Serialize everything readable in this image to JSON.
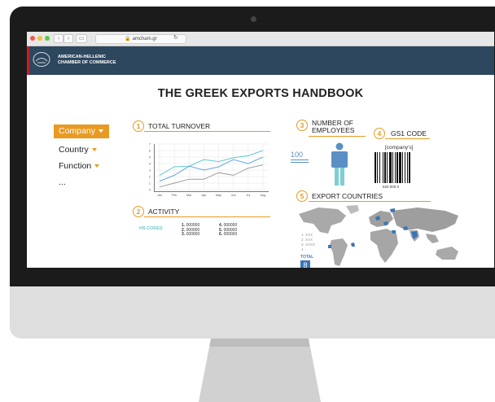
{
  "browser": {
    "url": "amcham.gr",
    "traffic_lights": [
      "#ee5b52",
      "#f5bd3a",
      "#5bc94a"
    ]
  },
  "header": {
    "org_line1": "AMERICAN-HELLENIC",
    "org_line2": "CHAMBER OF COMMERCE"
  },
  "page": {
    "title": "THE GREEK EXPORTS HANDBOOK"
  },
  "filters": {
    "items": [
      "Company",
      "Country",
      "Function",
      "..."
    ]
  },
  "sections": {
    "turnover": {
      "number": "1",
      "title": "TOTAL TURNOVER"
    },
    "activity": {
      "number": "2",
      "title": "ACTIVITY"
    },
    "employees": {
      "number": "3",
      "title_line1": "NUMBER OF",
      "title_line2": "EMPLOYEES",
      "count": "100"
    },
    "gs1": {
      "number": "4",
      "title": "GS1 CODE",
      "placeholder": "[company's]",
      "code_number": "520 000 0"
    },
    "export": {
      "number": "5",
      "title": "EXPORT COUNTRIES",
      "total_label": "TOTAL",
      "total_value": "8",
      "legend": [
        "1. XXX",
        "2. XXX",
        "3. XXXX",
        "4."
      ]
    }
  },
  "activity": {
    "hs_label": "HS CODES",
    "codes": [
      {
        "idx": "1.",
        "code": "000000"
      },
      {
        "idx": "2.",
        "code": "000000"
      },
      {
        "idx": "3.",
        "code": "000000"
      },
      {
        "idx": "4.",
        "code": "000000"
      },
      {
        "idx": "5.",
        "code": "000000"
      },
      {
        "idx": "6.",
        "code": "000000"
      }
    ]
  },
  "colors": {
    "accent": "#e89a22",
    "header_bg": "#2d475e",
    "header_accent": "#c81e2a",
    "figure": "#5b8fc6",
    "highlight": "#3a76b7"
  },
  "chart_data": {
    "type": "line",
    "categories": [
      "Jan",
      "Feb",
      "Mar",
      "Apr",
      "May",
      "Jun",
      "Jul",
      "Aug"
    ],
    "y_ticks": [
      "7",
      "6",
      "5",
      "4",
      "3",
      "2",
      "1",
      "0"
    ],
    "ylim": [
      0,
      7
    ],
    "grid": true,
    "series": [
      {
        "color": "#62c7d0",
        "values": [
          2.2,
          3.5,
          3.6,
          4.6,
          4.3,
          4.9,
          5.2,
          6.0
        ]
      },
      {
        "color": "#62a7dd",
        "values": [
          1.3,
          2.2,
          3.6,
          3.0,
          3.5,
          4.6,
          4.0,
          5.0
        ]
      },
      {
        "color": "#9e9e9e",
        "values": [
          0.4,
          1.0,
          1.6,
          1.6,
          2.6,
          2.2,
          3.3,
          3.8
        ]
      }
    ]
  }
}
